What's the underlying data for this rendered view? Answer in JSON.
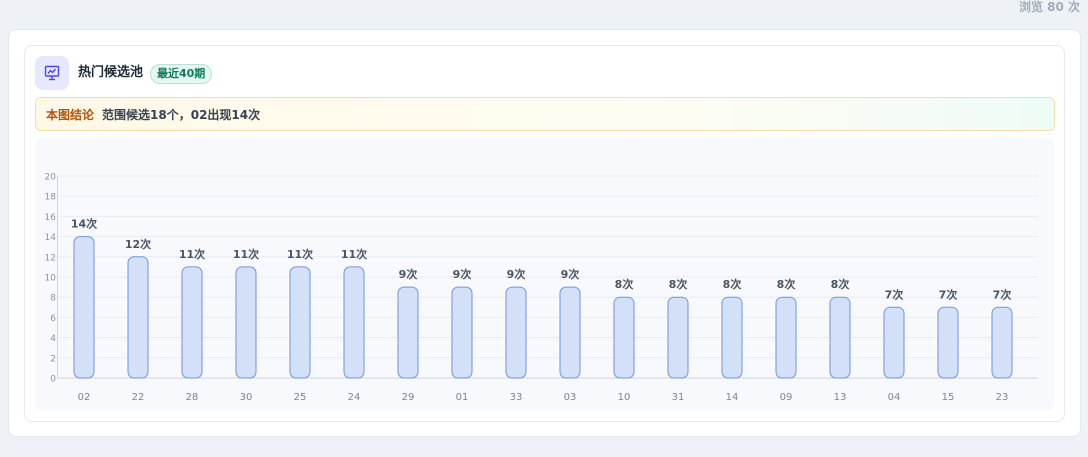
{
  "header": {
    "view_count": "浏览 80 次"
  },
  "card": {
    "title": "热门候选池",
    "badge": "最近40期",
    "icon": "presentation-chart-icon"
  },
  "conclusion": {
    "label": "本图结论",
    "text": "范围候选18个，02出现14次"
  },
  "colors": {
    "bar_fill": "#d3e0f8",
    "bar_stroke": "#6f95dc",
    "label": "#4b5563",
    "accent": "#5b4fd6"
  },
  "chart_data": {
    "type": "bar",
    "categories": [
      "02",
      "22",
      "28",
      "30",
      "25",
      "24",
      "29",
      "01",
      "33",
      "03",
      "10",
      "31",
      "14",
      "09",
      "13",
      "04",
      "15",
      "23"
    ],
    "values": [
      14,
      12,
      11,
      11,
      11,
      11,
      9,
      9,
      9,
      9,
      8,
      8,
      8,
      8,
      8,
      7,
      7,
      7
    ],
    "data_labels": [
      "14次",
      "12次",
      "11次",
      "11次",
      "11次",
      "11次",
      "9次",
      "9次",
      "9次",
      "9次",
      "8次",
      "8次",
      "8次",
      "8次",
      "8次",
      "7次",
      "7次",
      "7次"
    ],
    "yticks": [
      "0",
      "2",
      "4",
      "6",
      "8",
      "10",
      "12",
      "14",
      "16",
      "18",
      "20"
    ],
    "ylim": [
      0,
      20
    ],
    "grid": true
  }
}
